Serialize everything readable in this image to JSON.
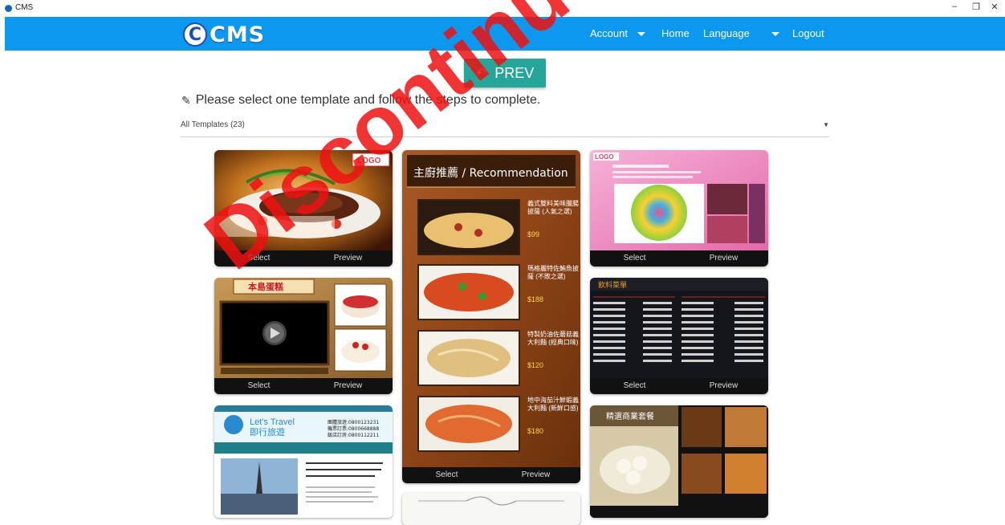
{
  "window": {
    "title": "CMS",
    "minimize": "–",
    "restore": "❐",
    "close": "✕"
  },
  "navbar": {
    "logo_letter": "C",
    "logo_text": "CMS",
    "account": "Account",
    "home": "Home",
    "language": "Language",
    "logout": "Logout"
  },
  "prev_label": "PREV",
  "instruction": "Please select one template and follow the steps to complete.",
  "filter": {
    "selected": "All Templates (23)"
  },
  "card_actions": {
    "select": "Select",
    "preview": "Preview"
  },
  "templates": {
    "logo_badge": "LOGO",
    "steak": {
      "caption": ""
    },
    "cake": {
      "header": "本島蛋糕"
    },
    "travel": {
      "title_en": "Let's Travel",
      "title_cn": "即行旅遊",
      "phones": [
        "團體旅遊:0800123231",
        "機票訂票:0800668888",
        "飯店訂房:0800112211"
      ]
    },
    "recommendation": {
      "title": "主廚推薦 / Recommendation",
      "items": [
        {
          "name": "義式雙料美味臘腸披薩 (人氣之選)",
          "price": "$99"
        },
        {
          "name": "瑪格麗特佐鮪魚披薩 (不敗之選)",
          "price": "$188"
        },
        {
          "name": "特製奶油佐蘑菇義大利麵 (經典口味)",
          "price": "$120"
        },
        {
          "name": "地中海茄汁鮮蝦義大利麵 (新鮮口感)",
          "price": "$180"
        }
      ]
    },
    "drinks": {
      "title": "飲料菜單"
    },
    "set_meal": {
      "title": "精選商業套餐"
    }
  },
  "colors": {
    "navbar": "#0c98ee",
    "prev": "#26a69a",
    "watermark": "#ee1111"
  },
  "icons": {
    "pencil": "pencil-icon",
    "back": "back-arrow-icon",
    "play": "play-icon"
  }
}
